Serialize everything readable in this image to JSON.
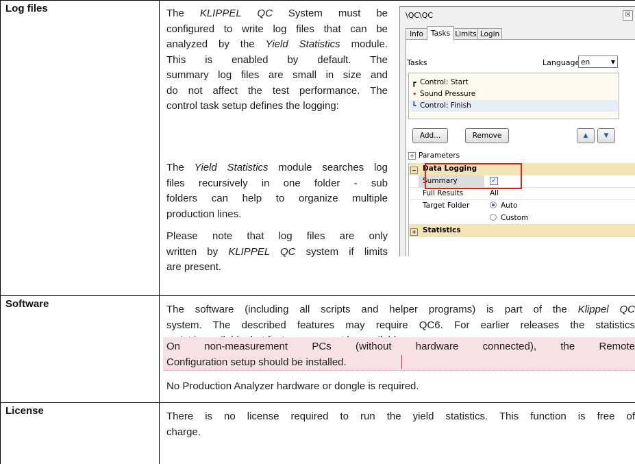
{
  "rows": [
    {
      "label": "Log files",
      "p1_lines": [
        "The <em>KLIPPEL QC</em> System must be",
        "configured to write log files that can be",
        "analyzed by the <em>Yield Statistics</em> module.",
        "This is enabled by default. The",
        "summary log files are small in size and",
        "do not affect the test performance. The",
        "control task setup defines the logging:"
      ],
      "p2_lines": [
        "The <em>Yield Statistics</em> module searches log",
        "files recursively in one folder - sub",
        "folders can help to organize multiple",
        "production lines."
      ],
      "p3_lines": [
        "Please note that log files are only",
        "written by <em>KLIPPEL QC</em> system if limits",
        "are present."
      ]
    },
    {
      "label": "Software",
      "p1_lines": [
        "The software (including all scripts and helper programs) is part of the <em>Klippel QC</em>",
        "system. The described features may require QC6. For earlier releases the statistics",
        "script is available, but features may not be available."
      ],
      "p2_lines": [
        "On non-measurement PCs (without hardware connected), the Remote",
        "Configuration setup should be installed."
      ],
      "p3": "No Production Analyzer hardware or dongle is required."
    },
    {
      "label": "License",
      "p1_lines": [
        "There is no license required to run the yield statistics. This function is free of",
        "charge."
      ]
    }
  ],
  "qc_window": {
    "title": "\\QC\\QC",
    "close": "☒",
    "tabs": [
      "Info",
      "Tasks",
      "Limits",
      "Login"
    ],
    "active_tab": "Tasks",
    "tasks_label": "Tasks",
    "language_label": "Language",
    "language_value": "en",
    "task_items": [
      {
        "icon": "┏",
        "label": "Control: Start"
      },
      {
        "icon": "•",
        "label": "Sound Pressure"
      },
      {
        "icon": "┗",
        "label": "Control: Finish"
      }
    ],
    "add_button": "Add...",
    "remove_button": "Remove",
    "parameters_label": "Parameters",
    "grid": {
      "data_logging": "Data Logging",
      "summary_label": "Summary",
      "summary_checked": true,
      "full_results_label": "Full Results",
      "full_results_value": "All",
      "target_folder_label": "Target Folder",
      "target_options": [
        "Auto",
        "Custom"
      ],
      "target_selected": "Auto",
      "statistics": "Statistics"
    },
    "colors": {
      "highlight_box": "#d82020",
      "group_header": "#f4e3b4",
      "task_list_bg": "#fffbf0"
    }
  },
  "colors": {
    "highlight_bg": "#f7e1e4"
  }
}
